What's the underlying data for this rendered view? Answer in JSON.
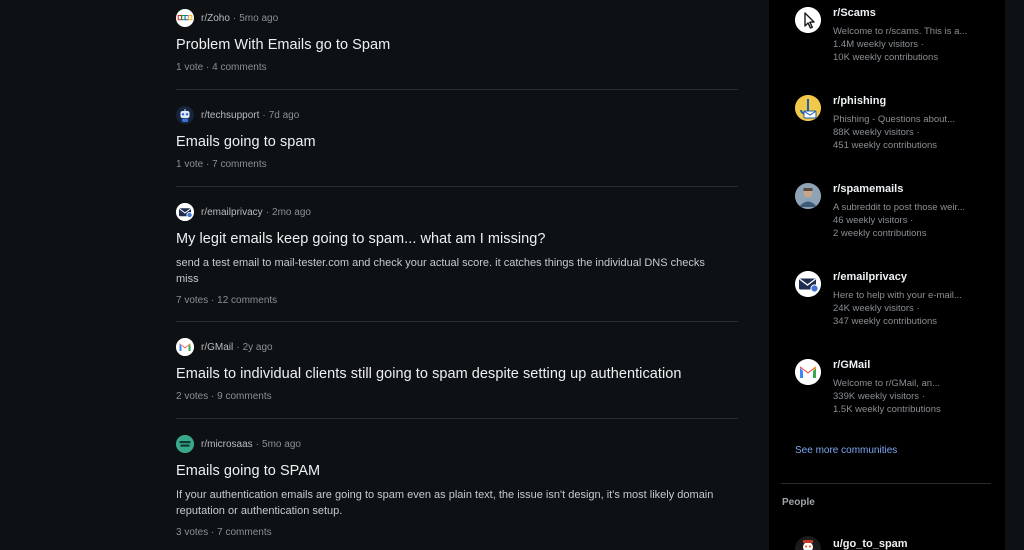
{
  "feed": {
    "posts": [
      {
        "subreddit": "r/Zoho",
        "age": "5mo ago",
        "title": "Problem With Emails go to Spam",
        "body": "",
        "stats": "1 vote · 4 comments",
        "icon": "zoho-icon"
      },
      {
        "subreddit": "r/techsupport",
        "age": "7d ago",
        "title": "Emails going to spam",
        "body": "",
        "stats": "1 vote · 7 comments",
        "icon": "techsupport-robot-icon"
      },
      {
        "subreddit": "r/emailprivacy",
        "age": "2mo ago",
        "title": "My legit emails keep going to spam... what am I missing?",
        "body": "send a test email to mail-tester.com and check your actual score. it catches things the individual DNS checks miss",
        "stats": "7 votes · 12 comments",
        "icon": "envelope-icon"
      },
      {
        "subreddit": "r/GMail",
        "age": "2y ago",
        "title": "Emails to individual clients still going to spam despite setting up authentication",
        "body": "",
        "stats": "2 votes · 9 comments",
        "icon": "gmail-icon"
      },
      {
        "subreddit": "r/microsaas",
        "age": "5mo ago",
        "title": "Emails going to SPAM",
        "body": "If your authentication emails are going to spam even as plain text, the issue isn't design, it's most likely domain reputation or authentication setup.",
        "stats": "3 votes · 7 comments",
        "icon": "microsaas-icon"
      }
    ]
  },
  "sidebar": {
    "communities": [
      {
        "name": "r/Scams",
        "desc": "Welcome to r/scams. This is a...",
        "visitors": "1.4M weekly visitors ·",
        "contributions": "10K weekly contributions",
        "icon": "cursor-arrow-icon"
      },
      {
        "name": "r/phishing",
        "desc": "Phishing - Questions about...",
        "visitors": "88K weekly visitors ·",
        "contributions": "451 weekly contributions",
        "icon": "phishing-hook-icon"
      },
      {
        "name": "r/spamemails",
        "desc": "A subreddit to post those weir...",
        "visitors": "46 weekly visitors ·",
        "contributions": "2 weekly contributions",
        "icon": "spamemails-photo-icon"
      },
      {
        "name": "r/emailprivacy",
        "desc": "Here to help with your e-mail...",
        "visitors": "24K weekly visitors ·",
        "contributions": "347 weekly contributions",
        "icon": "envelope-icon"
      },
      {
        "name": "r/GMail",
        "desc": "Welcome to r/GMail, an...",
        "visitors": "339K weekly visitors ·",
        "contributions": "1.5K weekly contributions",
        "icon": "gmail-icon"
      }
    ],
    "see_more": "See more communities",
    "people_heading": "People",
    "people": [
      {
        "name": "u/go_to_spam",
        "icon": "user-avatar-icon"
      }
    ]
  }
}
